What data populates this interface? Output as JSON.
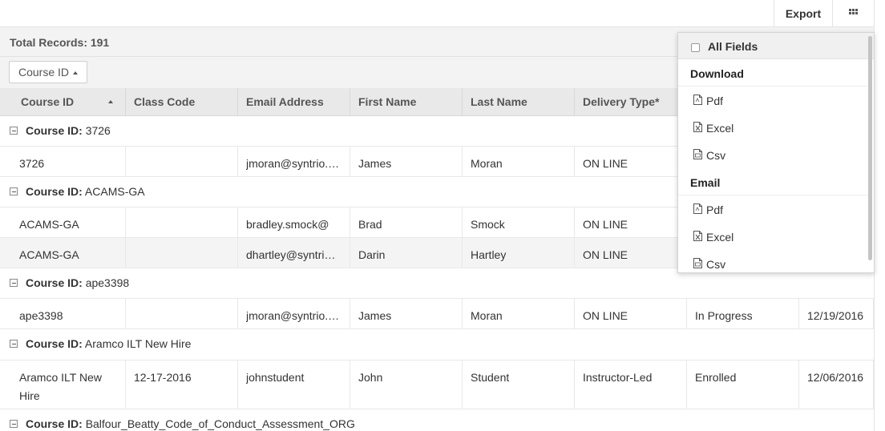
{
  "toolbar": {
    "export_label": "Export",
    "grid_icon": "grid-icon"
  },
  "summary": {
    "total_records": "Total Records: 191"
  },
  "grouping": {
    "chip_label": "Course ID"
  },
  "table": {
    "columns": [
      "Course ID",
      "Class Code",
      "Email Address",
      "First Name",
      "Last Name",
      "Delivery Type*",
      "",
      ""
    ],
    "groups": [
      {
        "label": "Course ID:",
        "value": "3726"
      },
      {
        "label": "Course ID:",
        "value": "ACAMS-GA"
      },
      {
        "label": "Course ID:",
        "value": "ape3398"
      },
      {
        "label": "Course ID:",
        "value": "Aramco ILT New Hire"
      },
      {
        "label": "Course ID:",
        "value": "Balfour_Beatty_Code_of_Conduct_Assessment_ORG"
      }
    ],
    "rows": [
      [
        "3726",
        "",
        "jmoran@syntrio.com",
        "James",
        "Moran",
        "ON LINE",
        "",
        ""
      ],
      [
        "ACAMS-GA",
        "",
        "bradley.smock@",
        "Brad",
        "Smock",
        "ON LINE",
        "",
        ""
      ],
      [
        "ACAMS-GA",
        "",
        "dhartley@syntrio.com",
        "Darin",
        "Hartley",
        "ON LINE",
        "",
        ""
      ],
      [
        "ape3398",
        "",
        "jmoran@syntrio.com",
        "James",
        "Moran",
        "ON LINE",
        "In Progress",
        "12/19/2016"
      ],
      [
        "Aramco ILT New Hire",
        "12-17-2016",
        "johnstudent",
        "John",
        "Student",
        "Instructor-Led",
        "Enrolled",
        "12/06/2016"
      ]
    ]
  },
  "export_menu": {
    "all_fields_label": "All Fields",
    "download_header": "Download",
    "download_items": [
      "Pdf",
      "Excel",
      "Csv"
    ],
    "email_header": "Email",
    "email_items": [
      "Pdf",
      "Excel",
      "Csv"
    ]
  }
}
